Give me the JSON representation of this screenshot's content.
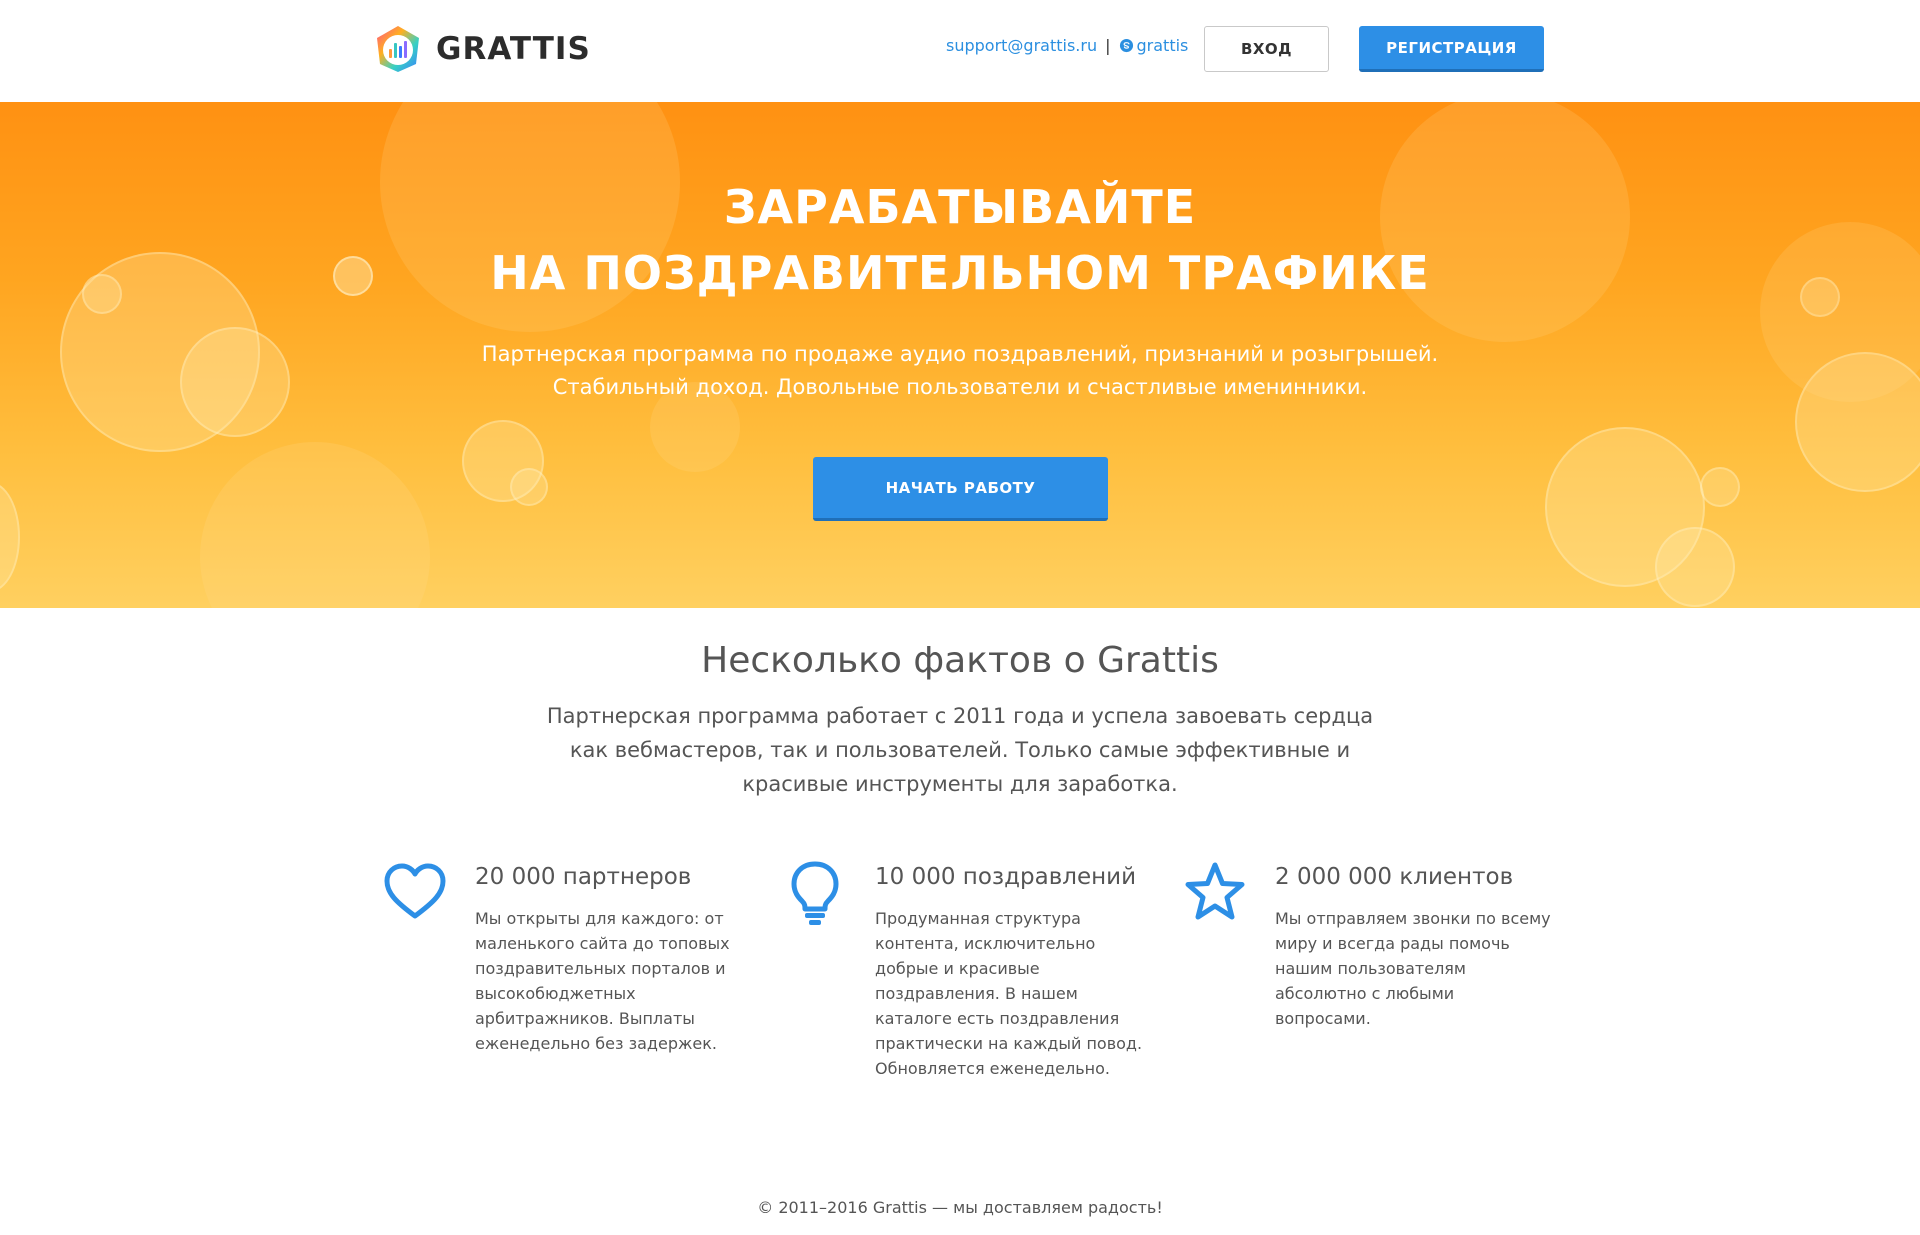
{
  "header": {
    "logo_text": "GRATTIS",
    "email": "support@grattis.ru",
    "separator": "|",
    "skype": "grattis",
    "login_label": "ВХОД",
    "register_label": "РЕГИСТРАЦИЯ"
  },
  "hero": {
    "title_line1": "ЗАРАБАТЫВАЙТЕ",
    "title_line2": "НА ПОЗДРАВИТЕЛЬНОМ ТРАФИКЕ",
    "subtitle_line1": "Партнерская программа по продаже аудио поздравлений, признаний и розыгрышей.",
    "subtitle_line2": "Стабильный доход. Довольные пользователи и счастливые именинники.",
    "cta_label": "НАЧАТЬ РАБОТУ"
  },
  "facts": {
    "title": "Несколько фактов о Grattis",
    "lead_line1": "Партнерская программа работает с 2011 года и успела завоевать сердца",
    "lead_line2": "как вебмастеров, так и пользователей. Только самые эффективные и",
    "lead_line3": "красивые инструменты для заработка.",
    "items": [
      {
        "icon": "heart-icon",
        "title": "20 000 партнеров",
        "text": "Мы открыты для каждого: от маленького сайта до топовых поздравительных порталов и высокобюджетных арбитражников. Выплаты еженедельно без задержек."
      },
      {
        "icon": "lightbulb-icon",
        "title": "10 000 поздравлений",
        "text": "Продуманная структура контента, исключительно добрые и красивые поздравления. В нашем каталоге есть поздравления практически на каждый повод. Обновляется еженедельно."
      },
      {
        "icon": "star-icon",
        "title": "2 000 000 клиентов",
        "text": "Мы отправляем звонки по всему миру и всегда рады помочь нашим пользователям абсолютно с любыми вопросами."
      }
    ]
  },
  "footer": {
    "copyright": "© 2011–2016 Grattis — мы доставляем радость!"
  },
  "colors": {
    "accent_blue": "#2d8fe6",
    "hero_orange": "#ff9112",
    "hero_yellow": "#ffd060",
    "text_gray": "#555555"
  }
}
